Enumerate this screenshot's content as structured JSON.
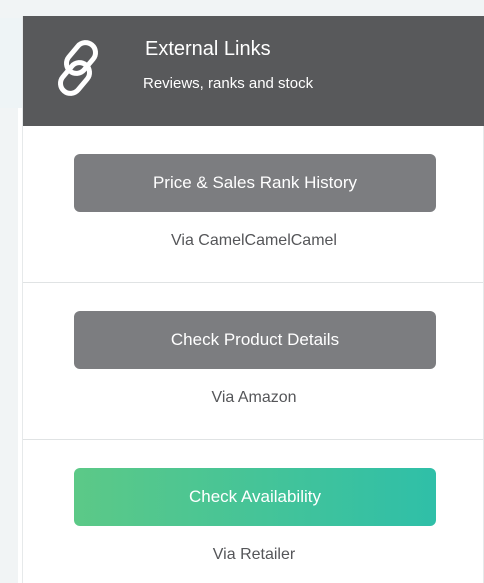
{
  "header": {
    "icon": "link-icon",
    "title": "External Links",
    "subtitle": "Reviews, ranks and stock",
    "background_color": "#58595b"
  },
  "sections": [
    {
      "button_label": "Price & Sales Rank History",
      "via": "Via CamelCamelCamel",
      "button_color": "#7c7d80"
    },
    {
      "button_label": "Check Product Details",
      "via": "Via Amazon",
      "button_color": "#7c7d80"
    },
    {
      "button_label": "Check Availability",
      "via": "Via Retailer",
      "button_color_start": "#5cc987",
      "button_color_end": "#2fbfa8"
    }
  ]
}
